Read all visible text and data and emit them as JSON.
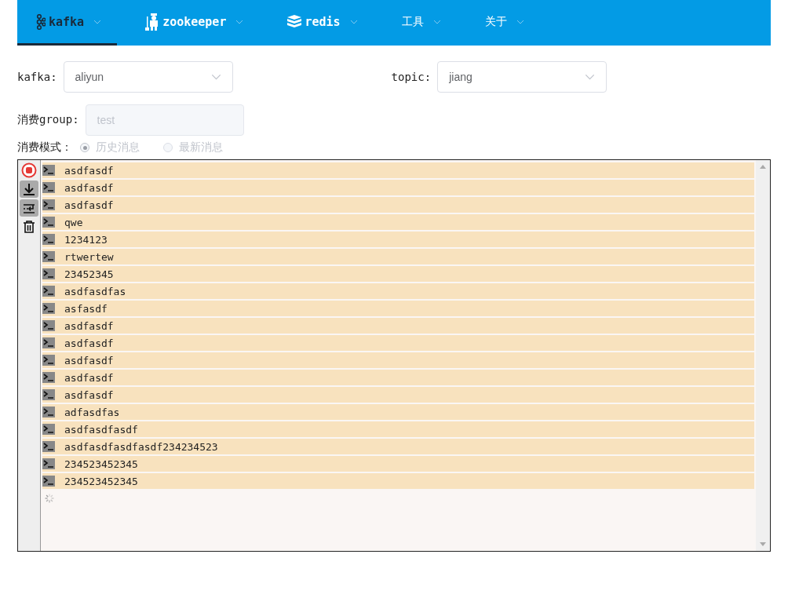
{
  "nav": {
    "items": [
      {
        "label": "kafka",
        "kind": "kafka",
        "selected": true
      },
      {
        "label": "zookeeper",
        "kind": "zookeeper",
        "selected": false
      },
      {
        "label": "redis",
        "kind": "redis",
        "selected": false
      },
      {
        "label": "工具",
        "kind": "plain",
        "selected": false
      },
      {
        "label": "关于",
        "kind": "plain",
        "selected": false
      }
    ]
  },
  "form": {
    "kafka": {
      "label": "kafka:",
      "value": "aliyun"
    },
    "topic": {
      "label": "topic:",
      "value": "jiang"
    },
    "group": {
      "label": "消费group:",
      "placeholder": "test",
      "disabled": true
    },
    "mode": {
      "label": "消费模式：",
      "disabled": true,
      "options": [
        {
          "label": "历史消息",
          "selected": true
        },
        {
          "label": "最新消息",
          "selected": false
        }
      ]
    }
  },
  "console": {
    "tools": [
      {
        "kind": "stop",
        "on": false
      },
      {
        "kind": "scroll",
        "on": true
      },
      {
        "kind": "wrap",
        "on": true
      },
      {
        "kind": "clear",
        "on": false
      }
    ],
    "lines": [
      "asdfasdf",
      "asdfasdf",
      "asdfasdf",
      "qwe",
      "1234123",
      "rtwertew",
      "23452345",
      "asdfasdfas",
      "asfasdf",
      "asdfasdf",
      "asdfasdf",
      "asdfasdf",
      "asdfasdf",
      "asdfasdf",
      "adfasdfas",
      "asdfasdfasdf",
      "asdfasdfasdfasdf234234523",
      "234523452345",
      "234523452345"
    ],
    "loading": true
  }
}
